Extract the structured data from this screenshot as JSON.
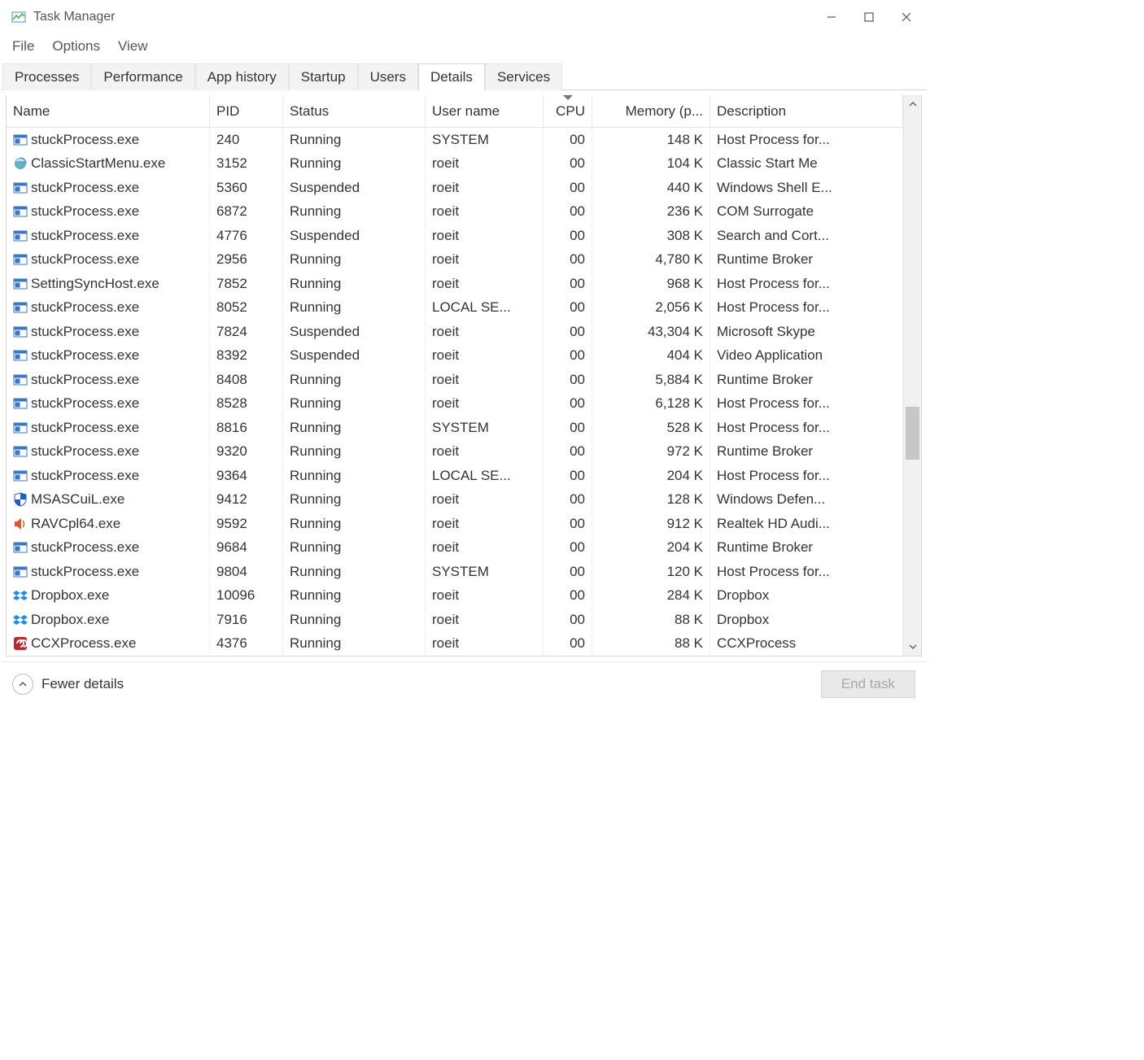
{
  "window": {
    "title": "Task Manager"
  },
  "menu": {
    "items": [
      "File",
      "Options",
      "View"
    ]
  },
  "tabs": {
    "items": [
      "Processes",
      "Performance",
      "App history",
      "Startup",
      "Users",
      "Details",
      "Services"
    ],
    "active_index": 5
  },
  "columns": {
    "name": "Name",
    "pid": "PID",
    "status": "Status",
    "user": "User name",
    "cpu": "CPU",
    "memory": "Memory (p...",
    "description": "Description"
  },
  "footer": {
    "fewer_details": "Fewer details",
    "end_task": "End task"
  },
  "processes": [
    {
      "icon": "default",
      "name": "stuckProcess.exe",
      "pid": "240",
      "status": "Running",
      "user": "SYSTEM",
      "cpu": "00",
      "memory": "148 K",
      "description": "Host Process for..."
    },
    {
      "icon": "shell",
      "name": "ClassicStartMenu.exe",
      "pid": "3152",
      "status": "Running",
      "user": "roeit",
      "cpu": "00",
      "memory": "104 K",
      "description": "Classic Start Me"
    },
    {
      "icon": "default",
      "name": "stuckProcess.exe",
      "pid": "5360",
      "status": "Suspended",
      "user": "roeit",
      "cpu": "00",
      "memory": "440 K",
      "description": "Windows Shell E..."
    },
    {
      "icon": "default",
      "name": "stuckProcess.exe",
      "pid": "6872",
      "status": "Running",
      "user": "roeit",
      "cpu": "00",
      "memory": "236 K",
      "description": "COM Surrogate"
    },
    {
      "icon": "default",
      "name": "stuckProcess.exe",
      "pid": "4776",
      "status": "Suspended",
      "user": "roeit",
      "cpu": "00",
      "memory": "308 K",
      "description": "Search and Cort..."
    },
    {
      "icon": "default",
      "name": "stuckProcess.exe",
      "pid": "2956",
      "status": "Running",
      "user": "roeit",
      "cpu": "00",
      "memory": "4,780 K",
      "description": "Runtime Broker"
    },
    {
      "icon": "default",
      "name": "SettingSyncHost.exe",
      "pid": "7852",
      "status": "Running",
      "user": "roeit",
      "cpu": "00",
      "memory": "968 K",
      "description": "Host Process for..."
    },
    {
      "icon": "default",
      "name": "stuckProcess.exe",
      "pid": "8052",
      "status": "Running",
      "user": "LOCAL SE...",
      "cpu": "00",
      "memory": "2,056 K",
      "description": "Host Process for..."
    },
    {
      "icon": "default",
      "name": "stuckProcess.exe",
      "pid": "7824",
      "status": "Suspended",
      "user": "roeit",
      "cpu": "00",
      "memory": "43,304 K",
      "description": "Microsoft Skype"
    },
    {
      "icon": "default",
      "name": "stuckProcess.exe",
      "pid": "8392",
      "status": "Suspended",
      "user": "roeit",
      "cpu": "00",
      "memory": "404 K",
      "description": "Video Application"
    },
    {
      "icon": "default",
      "name": "stuckProcess.exe",
      "pid": "8408",
      "status": "Running",
      "user": "roeit",
      "cpu": "00",
      "memory": "5,884 K",
      "description": "Runtime Broker"
    },
    {
      "icon": "default",
      "name": "stuckProcess.exe",
      "pid": "8528",
      "status": "Running",
      "user": "roeit",
      "cpu": "00",
      "memory": "6,128 K",
      "description": "Host Process for..."
    },
    {
      "icon": "default",
      "name": "stuckProcess.exe",
      "pid": "8816",
      "status": "Running",
      "user": "SYSTEM",
      "cpu": "00",
      "memory": "528 K",
      "description": "Host Process for..."
    },
    {
      "icon": "default",
      "name": "stuckProcess.exe",
      "pid": "9320",
      "status": "Running",
      "user": "roeit",
      "cpu": "00",
      "memory": "972 K",
      "description": "Runtime Broker"
    },
    {
      "icon": "default",
      "name": "stuckProcess.exe",
      "pid": "9364",
      "status": "Running",
      "user": "LOCAL SE...",
      "cpu": "00",
      "memory": "204 K",
      "description": "Host Process for..."
    },
    {
      "icon": "shield",
      "name": "MSASCuiL.exe",
      "pid": "9412",
      "status": "Running",
      "user": "roeit",
      "cpu": "00",
      "memory": "128 K",
      "description": "Windows Defen..."
    },
    {
      "icon": "speaker",
      "name": "RAVCpl64.exe",
      "pid": "9592",
      "status": "Running",
      "user": "roeit",
      "cpu": "00",
      "memory": "912 K",
      "description": "Realtek HD Audi..."
    },
    {
      "icon": "default",
      "name": "stuckProcess.exe",
      "pid": "9684",
      "status": "Running",
      "user": "roeit",
      "cpu": "00",
      "memory": "204 K",
      "description": "Runtime Broker"
    },
    {
      "icon": "default",
      "name": "stuckProcess.exe",
      "pid": "9804",
      "status": "Running",
      "user": "SYSTEM",
      "cpu": "00",
      "memory": "120 K",
      "description": "Host Process for..."
    },
    {
      "icon": "dropbox",
      "name": "Dropbox.exe",
      "pid": "10096",
      "status": "Running",
      "user": "roeit",
      "cpu": "00",
      "memory": "284 K",
      "description": "Dropbox"
    },
    {
      "icon": "dropbox",
      "name": "Dropbox.exe",
      "pid": "7916",
      "status": "Running",
      "user": "roeit",
      "cpu": "00",
      "memory": "88 K",
      "description": "Dropbox"
    },
    {
      "icon": "cc",
      "name": "CCXProcess.exe",
      "pid": "4376",
      "status": "Running",
      "user": "roeit",
      "cpu": "00",
      "memory": "88 K",
      "description": "CCXProcess"
    }
  ]
}
